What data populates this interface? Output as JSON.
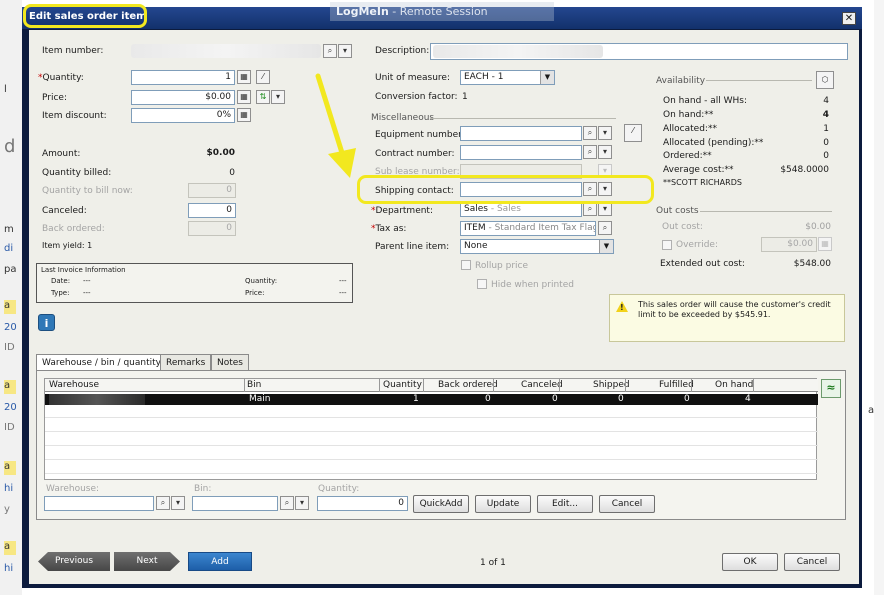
{
  "window": {
    "title": "Edit sales order item",
    "remote_banner_brand": "LogMeIn",
    "remote_banner_text": "- Remote Session"
  },
  "background": {
    "fragments": [
      "l",
      "d",
      "a",
      "20",
      "ID",
      "a",
      "20",
      "ID",
      "a",
      "hi",
      "y",
      "a",
      "hi",
      "a",
      "m",
      "di",
      "pa"
    ]
  },
  "left": {
    "item_number_label": "Item number:",
    "quantity_label": "Quantity:",
    "quantity_value": "1",
    "price_label": "Price:",
    "price_value": "$0.00",
    "item_discount_label": "Item discount:",
    "item_discount_value": "0%",
    "amount_label": "Amount:",
    "amount_value": "$0.00",
    "quantity_billed_label": "Quantity billed:",
    "quantity_billed_value": "0",
    "quantity_to_bill_now_label": "Quantity to bill now:",
    "quantity_to_bill_now_value": "0",
    "canceled_label": "Canceled:",
    "canceled_value": "0",
    "back_ordered_label": "Back ordered:",
    "back_ordered_value": "0",
    "item_yield_label": "Item yield: 1"
  },
  "last_invoice": {
    "title": "Last Invoice Information",
    "date_label": "Date:",
    "date_value": "---",
    "quantity_label": "Quantity:",
    "quantity_value": "---",
    "type_label": "Type:",
    "type_value": "---",
    "price_label": "Price:",
    "price_value": "---"
  },
  "middle": {
    "description_label": "Description:",
    "unit_of_measure_label": "Unit of measure:",
    "unit_of_measure_value": "EACH - 1",
    "conversion_factor_label": "Conversion factor:",
    "conversion_factor_value": "1",
    "misc_title": "Miscellaneous",
    "equipment_number_label": "Equipment number:",
    "contract_number_label": "Contract number:",
    "sub_lease_number_label": "Sub lease number:",
    "shipping_contact_label": "Shipping contact:",
    "department_label": "Department:",
    "department_value": "Sales",
    "department_sub": " - Sales",
    "tax_as_label": "Tax as:",
    "tax_as_value": "ITEM",
    "tax_as_sub": " - Standard Item Tax Flag",
    "parent_line_item_label": "Parent line item:",
    "parent_line_item_value": "None",
    "rollup_price_label": "Rollup price",
    "hide_when_printed_label": "Hide when printed"
  },
  "availability": {
    "title": "Availability",
    "rows": [
      {
        "label": "On hand - all WHs:",
        "value": "4",
        "bold": false
      },
      {
        "label": "On hand:**",
        "value": "4",
        "bold": true
      },
      {
        "label": "Allocated:**",
        "value": "1",
        "bold": false
      },
      {
        "label": "Allocated (pending):**",
        "value": "0",
        "bold": false
      },
      {
        "label": "Ordered:**",
        "value": "0",
        "bold": false
      },
      {
        "label": "Average cost:**",
        "value": "$548.0000",
        "bold": false
      }
    ],
    "footnote": "**SCOTT RICHARDS"
  },
  "out_costs": {
    "title": "Out costs",
    "out_cost_label": "Out cost:",
    "out_cost_value": "$0.00",
    "override_label": "Override:",
    "override_value": "$0.00",
    "extended_out_cost_label": "Extended out cost:",
    "extended_out_cost_value": "$548.00"
  },
  "warning": {
    "text": "This sales order will cause the customer's credit limit to be exceeded by $545.91."
  },
  "tabs": [
    {
      "label": "Warehouse / bin / quantity",
      "active": true
    },
    {
      "label": "Remarks",
      "active": false
    },
    {
      "label": "Notes",
      "active": false
    }
  ],
  "grid": {
    "columns": [
      "Warehouse",
      "Bin",
      "Quantity",
      "Back ordered",
      "Canceled",
      "Shipped",
      "Fulfilled",
      "On hand"
    ],
    "rows": [
      {
        "bin": "Main",
        "quantity": "1",
        "back_ordered": "0",
        "canceled": "0",
        "shipped": "0",
        "fulfilled": "0",
        "on_hand": "4"
      }
    ]
  },
  "grid_editor": {
    "warehouse_label": "Warehouse:",
    "bin_label": "Bin:",
    "quantity_label": "Quantity:",
    "quantity_value": "0",
    "quickadd_label": "QuickAdd",
    "update_label": "Update",
    "edit_label": "Edit...",
    "cancel_label": "Cancel"
  },
  "footer": {
    "previous_label": "Previous",
    "next_label": "Next",
    "add_label": "Add",
    "page_indicator": "1 of 1",
    "ok_label": "OK",
    "cancel_label": "Cancel"
  },
  "colors": {
    "highlight": "#f2e81f",
    "title_bar": "#1a3a7a",
    "add_button": "#2a6fbd"
  }
}
